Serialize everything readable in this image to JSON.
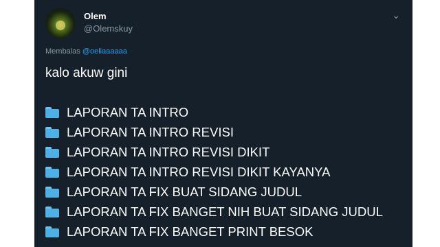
{
  "tweet": {
    "author": {
      "name": "Olem",
      "handle": "@Olemskuy"
    },
    "more_glyph": "⌄",
    "reply": {
      "prefix": "Membalas",
      "mention": "@oeliaaaaaa"
    },
    "text": "kalo akuw gini",
    "folders": [
      {
        "icon": "folder-icon",
        "label": "LAPORAN TA INTRO"
      },
      {
        "icon": "folder-icon",
        "label": "LAPORAN TA INTRO REVISI"
      },
      {
        "icon": "folder-icon",
        "label": "LAPORAN TA INTRO REVISI DIKIT"
      },
      {
        "icon": "folder-icon",
        "label": "LAPORAN TA INTRO REVISI DIKIT KAYANYA"
      },
      {
        "icon": "folder-icon",
        "label": "LAPORAN TA FIX BUAT SIDANG JUDUL"
      },
      {
        "icon": "folder-icon",
        "label": "LAPORAN TA FIX BANGET NIH BUAT SIDANG JUDUL"
      },
      {
        "icon": "folder-icon",
        "label": "LAPORAN TA FIX BANGET PRINT BESOK"
      }
    ]
  },
  "colors": {
    "background": "#15202b",
    "text": "#ffffff",
    "muted": "#8899a6",
    "link": "#1da1f2",
    "folder": "#4fb0e6"
  }
}
